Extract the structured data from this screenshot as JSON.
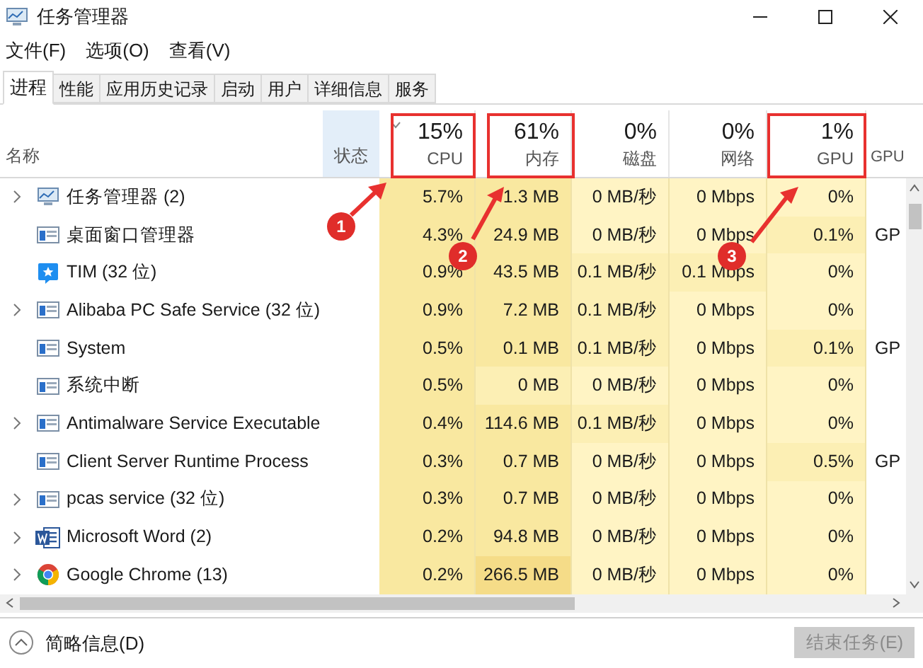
{
  "window": {
    "title": "任务管理器"
  },
  "menu": [
    "文件(F)",
    "选项(O)",
    "查看(V)"
  ],
  "tabs": [
    {
      "label": "进程",
      "selected": true
    },
    {
      "label": "性能",
      "selected": false
    },
    {
      "label": "应用历史记录",
      "selected": false
    },
    {
      "label": "启动",
      "selected": false
    },
    {
      "label": "用户",
      "selected": false
    },
    {
      "label": "详细信息",
      "selected": false
    },
    {
      "label": "服务",
      "selected": false
    }
  ],
  "table": {
    "name_column": "名称",
    "status_column": "状态",
    "columns": [
      {
        "value": "15%",
        "label": "CPU",
        "sorted": true
      },
      {
        "value": "61%",
        "label": "内存",
        "sorted": false
      },
      {
        "value": "0%",
        "label": "磁盘",
        "sorted": false
      },
      {
        "value": "0%",
        "label": "网络",
        "sorted": false
      },
      {
        "value": "1%",
        "label": "GPU",
        "sorted": false
      }
    ],
    "engine_column": "GPU",
    "rows": [
      {
        "name": "任务管理器 (2)",
        "kind": "taskmgr",
        "expandable": true,
        "cells": [
          {
            "text": "5.7%",
            "color": "#f9e8a0"
          },
          {
            "text": "1.3 MB",
            "color": "#f9e8a0"
          },
          {
            "text": "0 MB/秒",
            "color": "#fff4c4"
          },
          {
            "text": "0 Mbps",
            "color": "#fff4c4"
          },
          {
            "text": "0%",
            "color": "#fff4c4"
          }
        ]
      },
      {
        "name": "桌面窗口管理器",
        "kind": "window",
        "expandable": false,
        "engine": "GP",
        "cells": [
          {
            "text": "4.3%",
            "color": "#f9e8a0"
          },
          {
            "text": "24.9 MB",
            "color": "#f9e8a0"
          },
          {
            "text": "0 MB/秒",
            "color": "#fff4c4"
          },
          {
            "text": "0 Mbps",
            "color": "#fff4c4"
          },
          {
            "text": "0.1%",
            "color": "#fcefb4"
          }
        ]
      },
      {
        "name": "TIM (32 位)",
        "kind": "tim",
        "expandable": false,
        "cells": [
          {
            "text": "0.9%",
            "color": "#f9e8a0"
          },
          {
            "text": "43.5 MB",
            "color": "#f9e8a0"
          },
          {
            "text": "0.1 MB/秒",
            "color": "#fcefb4"
          },
          {
            "text": "0.1 Mbps",
            "color": "#fcefb4"
          },
          {
            "text": "0%",
            "color": "#fff4c4"
          }
        ]
      },
      {
        "name": "Alibaba PC Safe Service (32 位)",
        "kind": "window",
        "expandable": true,
        "cells": [
          {
            "text": "0.9%",
            "color": "#f9e8a0"
          },
          {
            "text": "7.2 MB",
            "color": "#f9e8a0"
          },
          {
            "text": "0.1 MB/秒",
            "color": "#fcefb4"
          },
          {
            "text": "0 Mbps",
            "color": "#fff4c4"
          },
          {
            "text": "0%",
            "color": "#fff4c4"
          }
        ]
      },
      {
        "name": "System",
        "kind": "window",
        "expandable": false,
        "engine": "GP",
        "cells": [
          {
            "text": "0.5%",
            "color": "#f9e8a0"
          },
          {
            "text": "0.1 MB",
            "color": "#f9e8a0"
          },
          {
            "text": "0.1 MB/秒",
            "color": "#fcefb4"
          },
          {
            "text": "0 Mbps",
            "color": "#fff4c4"
          },
          {
            "text": "0.1%",
            "color": "#fcefb4"
          }
        ]
      },
      {
        "name": "系统中断",
        "kind": "window",
        "expandable": false,
        "cells": [
          {
            "text": "0.5%",
            "color": "#f9e8a0"
          },
          {
            "text": "0 MB",
            "color": "#fcefb4"
          },
          {
            "text": "0 MB/秒",
            "color": "#fff4c4"
          },
          {
            "text": "0 Mbps",
            "color": "#fff4c4"
          },
          {
            "text": "0%",
            "color": "#fff4c4"
          }
        ]
      },
      {
        "name": "Antimalware Service Executable",
        "kind": "window",
        "expandable": true,
        "cells": [
          {
            "text": "0.4%",
            "color": "#f9e8a0"
          },
          {
            "text": "114.6 MB",
            "color": "#f9e8a0"
          },
          {
            "text": "0.1 MB/秒",
            "color": "#fcefb4"
          },
          {
            "text": "0 Mbps",
            "color": "#fff4c4"
          },
          {
            "text": "0%",
            "color": "#fff4c4"
          }
        ]
      },
      {
        "name": "Client Server Runtime Process",
        "kind": "window",
        "expandable": false,
        "engine": "GP",
        "cells": [
          {
            "text": "0.3%",
            "color": "#f9e8a0"
          },
          {
            "text": "0.7 MB",
            "color": "#f9e8a0"
          },
          {
            "text": "0 MB/秒",
            "color": "#fff4c4"
          },
          {
            "text": "0 Mbps",
            "color": "#fff4c4"
          },
          {
            "text": "0.5%",
            "color": "#fcefb4"
          }
        ]
      },
      {
        "name": "pcas service (32 位)",
        "kind": "window",
        "expandable": true,
        "cells": [
          {
            "text": "0.3%",
            "color": "#f9e8a0"
          },
          {
            "text": "0.7 MB",
            "color": "#f9e8a0"
          },
          {
            "text": "0 MB/秒",
            "color": "#fff4c4"
          },
          {
            "text": "0 Mbps",
            "color": "#fff4c4"
          },
          {
            "text": "0%",
            "color": "#fff4c4"
          }
        ]
      },
      {
        "name": "Microsoft Word (2)",
        "kind": "word",
        "expandable": true,
        "cells": [
          {
            "text": "0.2%",
            "color": "#f9e8a0"
          },
          {
            "text": "94.8 MB",
            "color": "#f9e8a0"
          },
          {
            "text": "0 MB/秒",
            "color": "#fff4c4"
          },
          {
            "text": "0 Mbps",
            "color": "#fff4c4"
          },
          {
            "text": "0%",
            "color": "#fff4c4"
          }
        ]
      },
      {
        "name": "Google Chrome (13)",
        "kind": "chrome",
        "expandable": true,
        "cells": [
          {
            "text": "0.2%",
            "color": "#f9e8a0"
          },
          {
            "text": "266.5 MB",
            "color": "#f5dc88"
          },
          {
            "text": "0 MB/秒",
            "color": "#fff4c4"
          },
          {
            "text": "0 Mbps",
            "color": "#fff4c4"
          },
          {
            "text": "0%",
            "color": "#fff4c4"
          }
        ]
      }
    ]
  },
  "annotations": [
    "1",
    "2",
    "3"
  ],
  "footer": {
    "toggle": "简略信息(D)",
    "end_task": {
      "label": "结束任务(E)",
      "disabled": true
    }
  }
}
